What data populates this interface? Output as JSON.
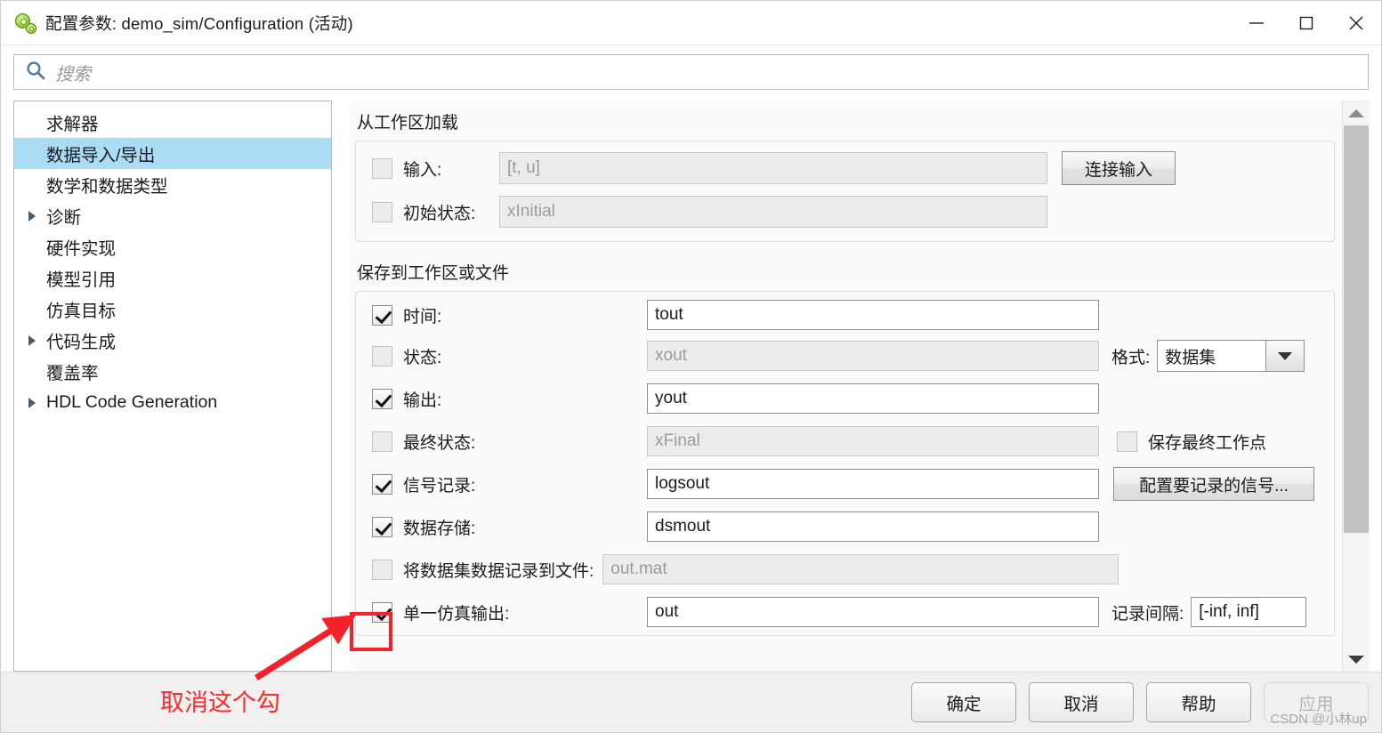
{
  "window": {
    "title": "配置参数: demo_sim/Configuration (活动)",
    "icon": "simulink-gear-icon",
    "controls": {
      "minimize": "minimize-icon",
      "maximize": "maximize-icon",
      "close": "close-icon"
    }
  },
  "search": {
    "icon": "search-icon",
    "placeholder": "搜索",
    "value": ""
  },
  "tree": {
    "items": [
      {
        "label": "求解器",
        "expandable": false,
        "selected": false
      },
      {
        "label": "数据导入/导出",
        "expandable": false,
        "selected": true
      },
      {
        "label": "数学和数据类型",
        "expandable": false,
        "selected": false
      },
      {
        "label": "诊断",
        "expandable": true,
        "selected": false
      },
      {
        "label": "硬件实现",
        "expandable": false,
        "selected": false
      },
      {
        "label": "模型引用",
        "expandable": false,
        "selected": false
      },
      {
        "label": "仿真目标",
        "expandable": false,
        "selected": false
      },
      {
        "label": "代码生成",
        "expandable": true,
        "selected": false
      },
      {
        "label": "覆盖率",
        "expandable": false,
        "selected": false
      },
      {
        "label": "HDL Code Generation",
        "expandable": true,
        "selected": false
      }
    ]
  },
  "load_section": {
    "title": "从工作区加载",
    "rows": [
      {
        "label": "输入:",
        "checked": false,
        "value": "[t, u]",
        "disabled": true
      },
      {
        "label": "初始状态:",
        "checked": false,
        "value": "xInitial",
        "disabled": true
      }
    ],
    "connect_input_button": "连接输入"
  },
  "save_section": {
    "title": "保存到工作区或文件",
    "rows": [
      {
        "label": "时间:",
        "checked": true,
        "value": "tout",
        "disabled": false
      },
      {
        "label": "状态:",
        "checked": false,
        "value": "xout",
        "disabled": true
      },
      {
        "label": "输出:",
        "checked": true,
        "value": "yout",
        "disabled": false
      },
      {
        "label": "最终状态:",
        "checked": false,
        "value": "xFinal",
        "disabled": true
      },
      {
        "label": "信号记录:",
        "checked": true,
        "value": "logsout",
        "disabled": false
      },
      {
        "label": "数据存储:",
        "checked": true,
        "value": "dsmout",
        "disabled": false
      },
      {
        "label": "将数据集数据记录到文件:",
        "checked": false,
        "value": "out.mat",
        "disabled": true
      },
      {
        "label": "单一仿真输出:",
        "checked": true,
        "value": "out",
        "disabled": false
      }
    ],
    "format_label": "格式:",
    "format_value": "数据集",
    "save_final_op_label": "保存最终工作点",
    "save_final_op_checked": false,
    "configure_signals_button": "配置要记录的信号...",
    "logging_interval_label": "记录间隔:",
    "logging_interval_value": "[-inf, inf]"
  },
  "scrollbar": {
    "up": "scroll-up-arrow-icon",
    "down": "scroll-down-arrow-icon"
  },
  "footer": {
    "buttons": [
      {
        "label": "确定",
        "disabled": false
      },
      {
        "label": "取消",
        "disabled": false
      },
      {
        "label": "帮助",
        "disabled": false
      },
      {
        "label": "应用",
        "disabled": true
      }
    ],
    "watermark": "CSDN @小林up"
  },
  "annotation": {
    "text": "取消这个勾",
    "color": "#ff2a2a"
  }
}
